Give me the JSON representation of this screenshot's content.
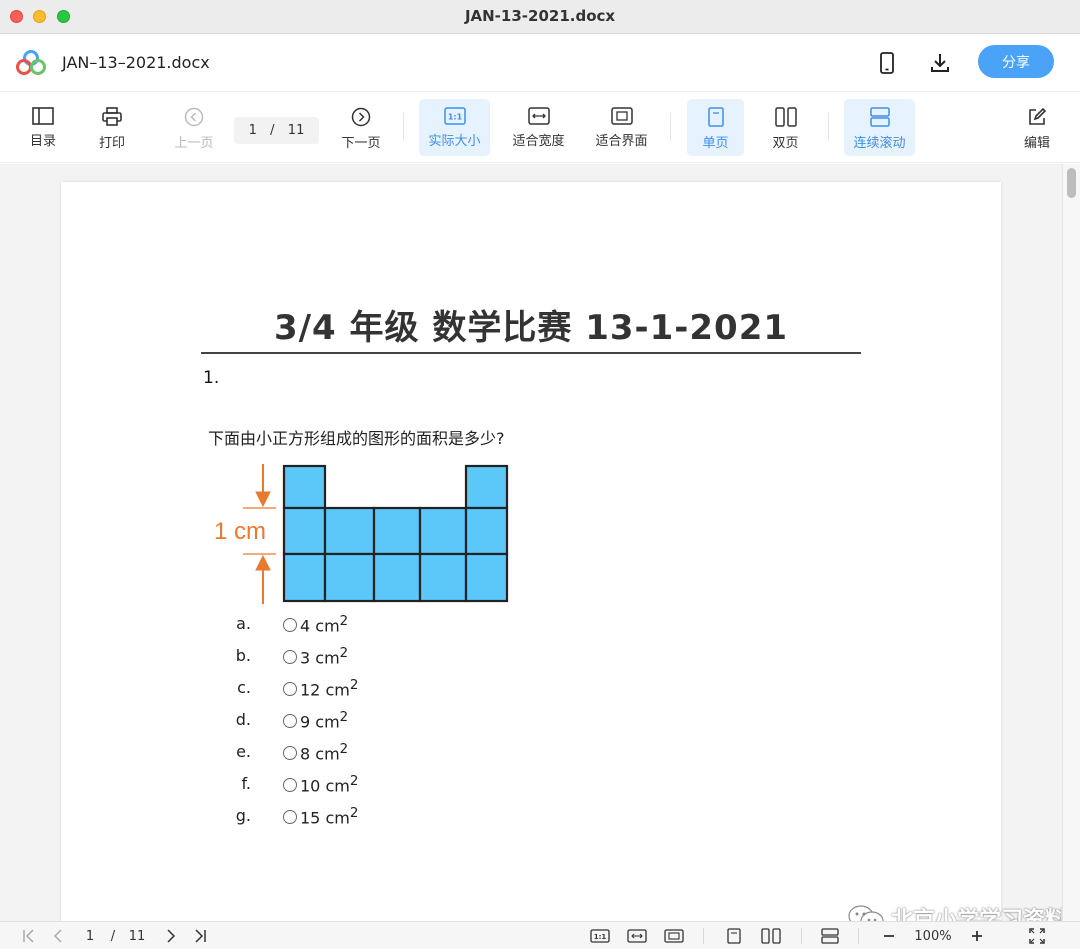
{
  "window": {
    "title": "JAN-13-2021.docx"
  },
  "header": {
    "doc_name": "JAN–13–2021.docx",
    "share_label": "分享"
  },
  "toolbar": {
    "toc": "目录",
    "print": "打印",
    "prev": "上一页",
    "page_current": "1",
    "page_sep": "/",
    "page_total": "11",
    "next": "下一页",
    "actual_size": "实际大小",
    "fit_width": "适合宽度",
    "fit_screen": "适合界面",
    "single_page": "单页",
    "double_page": "双页",
    "continuous": "连续滚动",
    "edit": "编辑"
  },
  "document": {
    "title": "3/4 年级 数学比赛 13-1-2021",
    "question_number": "1.",
    "question_text": "下面由小正方形组成的图形的面积是多少?",
    "figure_label": "1 cm",
    "options": [
      {
        "letter": "a.",
        "value": "4 cm",
        "sup": "2"
      },
      {
        "letter": "b.",
        "value": "3 cm",
        "sup": "2"
      },
      {
        "letter": "c.",
        "value": "12 cm",
        "sup": "2"
      },
      {
        "letter": "d.",
        "value": "9 cm",
        "sup": "2"
      },
      {
        "letter": "e.",
        "value": "8 cm",
        "sup": "2"
      },
      {
        "letter": "f.",
        "value": "10 cm",
        "sup": "2"
      },
      {
        "letter": "g.",
        "value": "15 cm",
        "sup": "2"
      }
    ],
    "watermark": "北京小学学习资料"
  },
  "statusbar": {
    "page_current": "1",
    "page_sep": "/",
    "page_total": "11",
    "zoom": "100%"
  },
  "colors": {
    "accent": "#4aa3f7",
    "square_fill": "#5bc8f9",
    "arrow": "#e87a2e"
  }
}
